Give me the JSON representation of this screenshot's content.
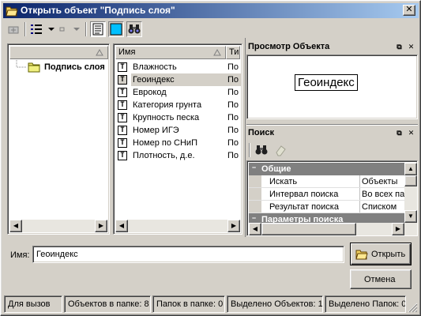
{
  "window": {
    "title": "Открыть объект \"Подпись слоя\"",
    "close": "✕"
  },
  "toolbar": {
    "view_icon": "details-view-icon",
    "dropdown_icon": "chevron-down-icon",
    "preview_icon": "preview-icon",
    "search_icon": "binoculars-icon"
  },
  "tree": {
    "items": [
      {
        "label": "Подпись слоя"
      }
    ]
  },
  "list": {
    "columns": [
      "Имя",
      "Ти"
    ],
    "rows": [
      {
        "name": "Влажность",
        "type": "По"
      },
      {
        "name": "Геоиндекс",
        "type": "По"
      },
      {
        "name": "Еврокод",
        "type": "По"
      },
      {
        "name": "Категория грунта",
        "type": "По"
      },
      {
        "name": "Крупность песка",
        "type": "По"
      },
      {
        "name": "Номер ИГЭ",
        "type": "По"
      },
      {
        "name": "Номер по СНиП",
        "type": "По"
      },
      {
        "name": "Плотность, д.е.",
        "type": "По"
      }
    ],
    "selected_index": 1,
    "icon_glyph": "T"
  },
  "preview": {
    "title": "Просмотр Объекта",
    "text": "Геоиндекс"
  },
  "search": {
    "title": "Поиск",
    "sections": [
      {
        "label": "Общие",
        "rows": [
          {
            "name": "Искать",
            "value": "Объекты"
          },
          {
            "name": "Интервал поиска",
            "value": "Во всех па"
          },
          {
            "name": "Результат поиска",
            "value": "Списком"
          }
        ]
      },
      {
        "label": "Параметры поиска"
      }
    ]
  },
  "form": {
    "name_label": "Имя:",
    "name_value": "Геоиндекс",
    "open_button": "Открыть",
    "cancel_button": "Отмена"
  },
  "statusbar": {
    "cells": [
      "Для вызов",
      "Объектов в папке: 8",
      "Папок в папке: 0",
      "Выделено Объектов: 1",
      "Выделено Папок: 0"
    ]
  },
  "colors": {
    "title_start": "#0a246a",
    "title_end": "#a6caf0",
    "selection": "#d4d0c8",
    "preview_fill": "#00c0ff"
  }
}
